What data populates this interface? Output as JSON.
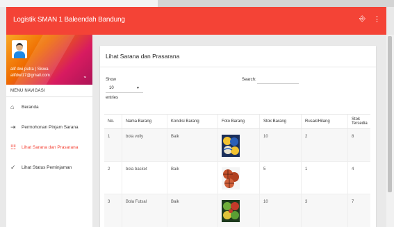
{
  "app": {
    "title": "Logistik SMAN 1 Baleendah Bandung",
    "exit_icon": "⎆",
    "menu_icon": "⋮"
  },
  "profile": {
    "name": "alif dwi putra | Siswa",
    "email": "alifdwi17@gmail.com",
    "chevron": "⌄"
  },
  "nav": {
    "header": "MENU NAVIGASI",
    "items": [
      {
        "icon": "home-icon",
        "glyph": "⌂",
        "label": "Beranda"
      },
      {
        "icon": "login-icon",
        "glyph": "⇥",
        "label": "Permohonan Pinjam Sarana"
      },
      {
        "icon": "list-icon",
        "glyph": "☷",
        "label": "Lihat Sarana dan Prasarana"
      },
      {
        "icon": "check-icon",
        "glyph": "✓",
        "label": "Lihat Status Peminjaman"
      }
    ]
  },
  "colors": {
    "accent": "#f44336"
  },
  "page": {
    "title": "Lihat Sarana dan Prasarana",
    "show_label": "Show",
    "entries_value": "10",
    "entries_label": "entries",
    "search_label": "Search:",
    "search_value": ""
  },
  "table": {
    "headers": [
      "No.",
      "Nama Barang",
      "Kondisi Barang",
      "Foto Barang",
      "Stok Barang",
      "Rusak/Hilang",
      "Stok Tersedia"
    ],
    "rows": [
      {
        "no": "1",
        "name": "bola volly",
        "condition": "Baik",
        "photo": "volleyball-photo",
        "stock": "10",
        "damaged": "2",
        "available": "8"
      },
      {
        "no": "2",
        "name": "bola basket",
        "condition": "Baik",
        "photo": "basketball-photo",
        "stock": "5",
        "damaged": "1",
        "available": "4"
      },
      {
        "no": "3",
        "name": "Bola Futsal",
        "condition": "Baik",
        "photo": "futsal-ball-photo",
        "stock": "10",
        "damaged": "3",
        "available": "7"
      }
    ]
  }
}
